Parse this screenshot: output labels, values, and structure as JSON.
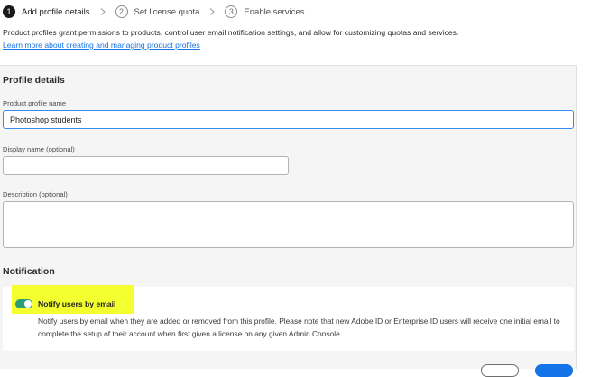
{
  "stepper": {
    "steps": [
      {
        "number": "1",
        "label": "Add profile details",
        "state": "active"
      },
      {
        "number": "2",
        "label": "Set license quota",
        "state": "inactive"
      },
      {
        "number": "3",
        "label": "Enable services",
        "state": "inactive"
      }
    ]
  },
  "intro": {
    "text": "Product profiles grant permissions to products, control user email notification settings, and allow for customizing quotas and services.",
    "link": "Learn more about creating and managing product profiles"
  },
  "profile_details": {
    "title": "Profile details",
    "name_label": "Product profile name",
    "name_value": "Photoshop students",
    "display_label": "Display name (optional)",
    "display_value": "",
    "description_label": "Description (optional)",
    "description_value": ""
  },
  "notification": {
    "title": "Notification",
    "toggle_label": "Notify users by email",
    "toggle_on": true,
    "description": "Notify users by email when they are added or removed from this profile. Please note that new Adobe ID or Enterprise ID users will receive one initial email to complete the setup of their account when first given a license on any given Admin Console."
  },
  "colors": {
    "accent": "#1473e6",
    "toggle_on": "#2d9d78",
    "highlight": "#f3ff2e",
    "panel_bg": "#f5f5f5"
  }
}
